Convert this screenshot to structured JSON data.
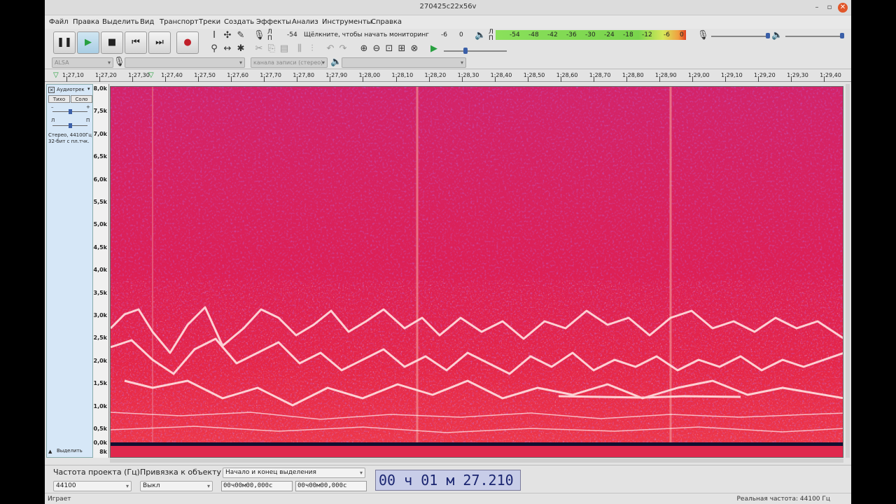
{
  "window": {
    "title": "270425c22x56v"
  },
  "menu": [
    "Файл",
    "Правка",
    "Выделить",
    "Вид",
    "Транспорт",
    "Треки",
    "Создать",
    "Эффекты",
    "Анализ",
    "Инструменты",
    "Справка"
  ],
  "meter": {
    "rec_l": "Л",
    "rec_r": "П",
    "rec_value": "-54",
    "monitor_text": "Щёлкните, чтобы начать мониторинг",
    "rec_m6": "-6",
    "rec_zero": "0",
    "play_l": "Л",
    "play_r": "П",
    "play_ticks": [
      "-54",
      "-48",
      "-42",
      "-36",
      "-30",
      "-24",
      "-18",
      "-12",
      "-6",
      "0"
    ]
  },
  "device": {
    "host": "ALSA",
    "channels": "канала записи (стерео)"
  },
  "ruler": {
    "ticks": [
      "1:27,10",
      "1:27,20",
      "1:27,30",
      "1:27,40",
      "1:27,50",
      "1:27,60",
      "1:27,70",
      "1:27,80",
      "1:27,90",
      "1:28,00",
      "1:28,10",
      "1:28,20",
      "1:28,30",
      "1:28,40",
      "1:28,50",
      "1:28,60",
      "1:28,70",
      "1:28,80",
      "1:28,90",
      "1:29,00",
      "1:29,10",
      "1:29,20",
      "1:29,30",
      "1:29,40"
    ]
  },
  "track": {
    "name": "Аудиотрек",
    "mute": "Тихо",
    "solo": "Соло",
    "gain_minus": "–",
    "gain_plus": "+",
    "pan_l": "Л",
    "pan_r": "П",
    "info1": "Стерео, 44100Гц",
    "info2": "32-бит с пл.тчк.",
    "select": "Выделить"
  },
  "freq_scale": [
    "8,0k",
    "7,5k",
    "7,0k",
    "6,5k",
    "6,0k",
    "5,5k",
    "5,0k",
    "4,5k",
    "4,0k",
    "3,5k",
    "3,0k",
    "2,5k",
    "2,0k",
    "1,5k",
    "1,0k",
    "0,5k",
    "0,0k",
    "8k"
  ],
  "selection": {
    "rate_label": "Частота проекта (Гц)",
    "rate_value": "44100",
    "snap_label": "Привязка к объекту",
    "snap_value": "Выкл",
    "mode": "Начало и конец выделения",
    "start": "00ч00м00,000с",
    "end": "00ч00м00,000с",
    "time": "00 ч 01 м 27.210 с"
  },
  "status": {
    "left": "Играет",
    "right": "Реальная частота: 44100 Гц"
  }
}
